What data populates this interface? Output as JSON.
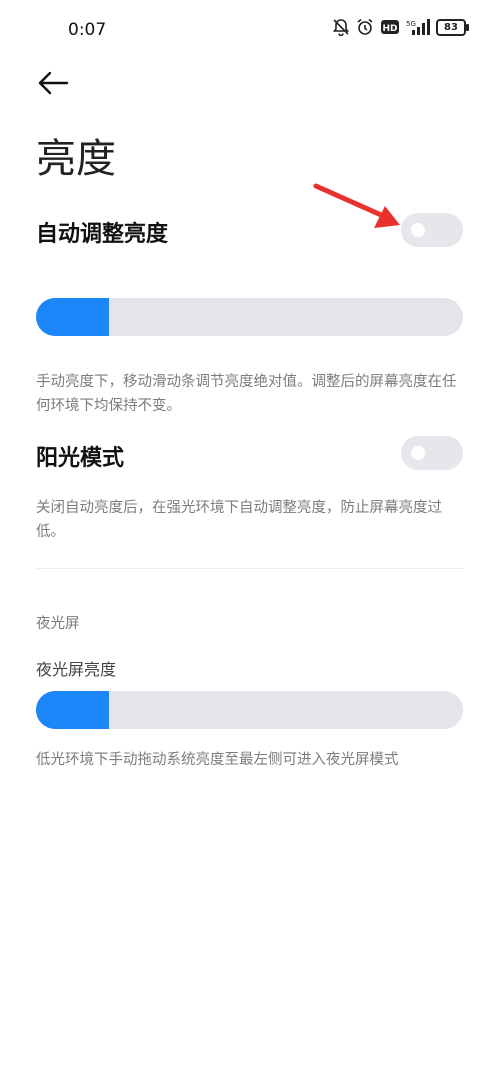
{
  "status_bar": {
    "time": "0:07",
    "network": "5G",
    "battery": "83",
    "icons": [
      "mute-bell-icon",
      "alarm-icon",
      "hd-icon",
      "5g-signal-icon",
      "battery-icon"
    ]
  },
  "header": {
    "back_icon": "back-arrow-icon",
    "title": "亮度"
  },
  "auto_brightness": {
    "label": "自动调整亮度",
    "enabled": false
  },
  "brightness_slider": {
    "level": 0.17
  },
  "manual_desc": "手动亮度下，移动滑动条调节亮度绝对值。调整后的屏幕亮度在任何环境下均保持不变。",
  "sunlight_mode": {
    "label": "阳光模式",
    "enabled": false,
    "desc": "关闭自动亮度后，在强光环境下自动调整亮度，防止屏幕亮度过低。"
  },
  "night_screen": {
    "section_title": "夜光屏",
    "label": "夜光屏亮度",
    "level": 0.17,
    "desc": "低光环境下手动拖动系统亮度至最左侧可进入夜光屏模式"
  },
  "colors": {
    "accent": "#1a86f7",
    "track": "#e4e5ea",
    "toggle_off": "#e6e7ec",
    "annotation_arrow": "#e8312f"
  }
}
